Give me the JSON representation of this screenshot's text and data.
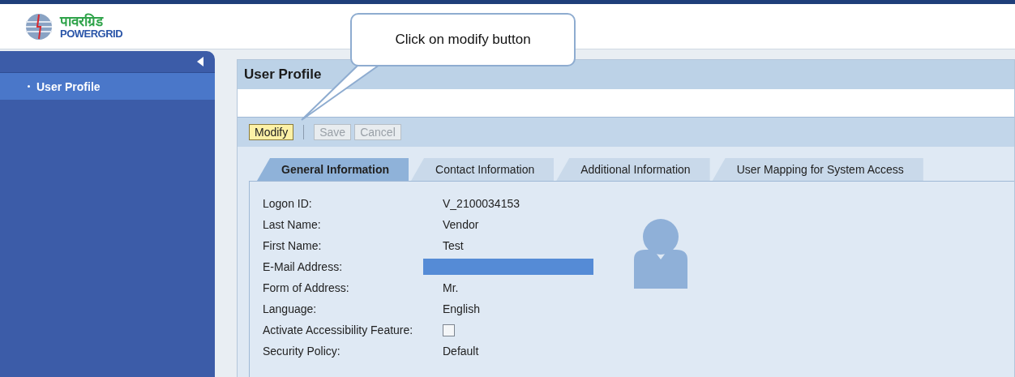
{
  "header": {
    "logo_hindi": "पावरग्रिड",
    "logo_text": "POWERGRID"
  },
  "sidebar": {
    "items": [
      {
        "label": "User Profile",
        "selected": true
      }
    ]
  },
  "panel": {
    "title": "User Profile"
  },
  "toolbar": {
    "buttons": [
      {
        "label": "Modify",
        "disabled": false
      },
      {
        "label": "Save",
        "disabled": true
      },
      {
        "label": "Cancel",
        "disabled": true
      }
    ]
  },
  "tabs": [
    {
      "label": "General Information",
      "selected": true
    },
    {
      "label": "Contact Information",
      "selected": false
    },
    {
      "label": "Additional Information",
      "selected": false
    },
    {
      "label": "User Mapping for System Access",
      "selected": false
    }
  ],
  "fields": [
    {
      "kind": "text",
      "label": "Logon ID:",
      "value": "V_2100034153"
    },
    {
      "kind": "text",
      "label": "Last Name:",
      "value": "Vendor"
    },
    {
      "kind": "text",
      "label": "First Name:",
      "value": "Test"
    },
    {
      "kind": "redacted",
      "label": "E-Mail Address:"
    },
    {
      "kind": "text",
      "label": "Form of Address:",
      "value": "Mr."
    },
    {
      "kind": "text",
      "label": "Language:",
      "value": "English"
    },
    {
      "kind": "checkbox",
      "label": "Activate Accessibility Feature:",
      "checked": false
    },
    {
      "kind": "text",
      "label": "Security Policy:",
      "value": "Default"
    }
  ],
  "callout": {
    "text": "Click on modify button"
  }
}
